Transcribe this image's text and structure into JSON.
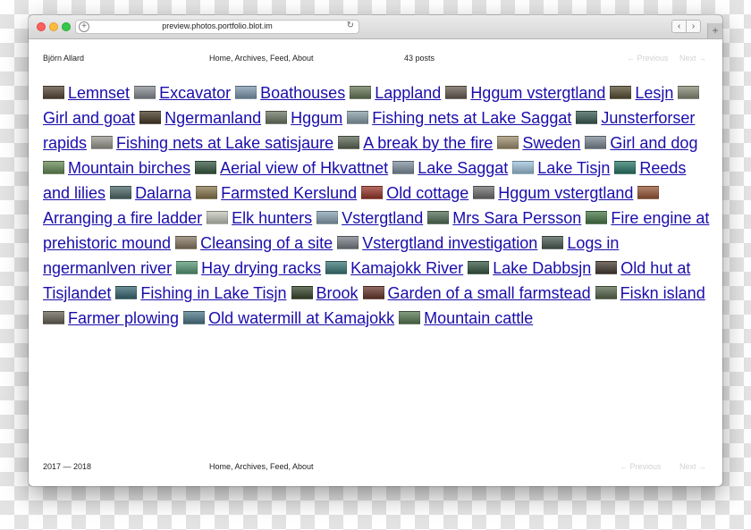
{
  "browser": {
    "url": "preview.photos.portfolio.blot.im",
    "new_tab": "+",
    "back": "‹",
    "forward": "›",
    "reload": "↻"
  },
  "header": {
    "site_name": "Björn Allard",
    "nav": "Home, Archives, Feed, About",
    "post_count": "43 posts",
    "previous": "← Previous",
    "next": "Next →"
  },
  "footer": {
    "years": "2017 — 2018",
    "nav": "Home, Archives, Feed, About",
    "previous": "← Previous",
    "next": "Next →"
  },
  "posts": [
    {
      "title": "Lemnset",
      "thumb": "#5a4a3a"
    },
    {
      "title": "Excavator",
      "thumb": "#8a8f95"
    },
    {
      "title": "Boathouses",
      "thumb": "#7f9ab0"
    },
    {
      "title": "Lappland",
      "thumb": "#6a7a5a"
    },
    {
      "title": "Hggum vstergtland",
      "thumb": "#6b5e55"
    },
    {
      "title": "Lesjn",
      "thumb": "#5a5236"
    },
    {
      "title": "Girl and goat",
      "thumb": "#8a8c78"
    },
    {
      "title": "Ngermanland",
      "thumb": "#4a3c2a"
    },
    {
      "title": "Hggum",
      "thumb": "#6d7a64"
    },
    {
      "title": "Fishing nets at Lake Saggat",
      "thumb": "#8aa0a8"
    },
    {
      "title": "Junsterforser rapids",
      "thumb": "#3e5f55"
    },
    {
      "title": "Fishing nets at Lake satisjaure",
      "thumb": "#9b9a90"
    },
    {
      "title": "A break by the fire",
      "thumb": "#5e6a58"
    },
    {
      "title": "Sweden",
      "thumb": "#a09070"
    },
    {
      "title": "Girl and dog",
      "thumb": "#7d8a94"
    },
    {
      "title": "Mountain birches",
      "thumb": "#6a8c5a"
    },
    {
      "title": "Aerial view of Hkvattnet",
      "thumb": "#3a5a44"
    },
    {
      "title": "Lake Saggat",
      "thumb": "#8090a0"
    },
    {
      "title": "Lake Tisjn",
      "thumb": "#9fc4dc"
    },
    {
      "title": "Reeds and lilies",
      "thumb": "#2e7a6a"
    },
    {
      "title": "Dalarna",
      "thumb": "#4f6b6a"
    },
    {
      "title": "Farmsted Kerslund",
      "thumb": "#8a7a50"
    },
    {
      "title": "Old cottage",
      "thumb": "#9a3a2e"
    },
    {
      "title": "Hggum vstergtland",
      "thumb": "#707070"
    },
    {
      "title": "Arranging a fire ladder",
      "thumb": "#9a5a3a"
    },
    {
      "title": "Elk hunters",
      "thumb": "#c4c8bc"
    },
    {
      "title": "Vstergtland",
      "thumb": "#8aa4b4"
    },
    {
      "title": "Mrs Sara Persson",
      "thumb": "#56705a"
    },
    {
      "title": "Fire engine at prehistoric mound",
      "thumb": "#4a7a4a"
    },
    {
      "title": "Cleansing of a site",
      "thumb": "#8a7a64"
    },
    {
      "title": "Vstergtland investigation",
      "thumb": "#7a8088"
    },
    {
      "title": "Logs in ngermanlven river",
      "thumb": "#4e5e56"
    },
    {
      "title": "Hay drying racks",
      "thumb": "#5a9a7a"
    },
    {
      "title": "Kamajokk River",
      "thumb": "#3e7a7a"
    },
    {
      "title": "Lake Dabbsjn",
      "thumb": "#3a5a44"
    },
    {
      "title": "Old hut at Tisjlandet",
      "thumb": "#4a3e34"
    },
    {
      "title": "Fishing in Lake Tisjn",
      "thumb": "#3a6a74"
    },
    {
      "title": "Brook",
      "thumb": "#3a4a2e"
    },
    {
      "title": "Garden of a small farmstead",
      "thumb": "#6a3a2e"
    },
    {
      "title": "Fiskn island",
      "thumb": "#5a6a4e"
    },
    {
      "title": "Farmer plowing",
      "thumb": "#6a6458"
    },
    {
      "title": "Old watermill at Kamajokk",
      "thumb": "#4e7a8a"
    },
    {
      "title": "Mountain cattle",
      "thumb": "#5a7a54"
    }
  ]
}
